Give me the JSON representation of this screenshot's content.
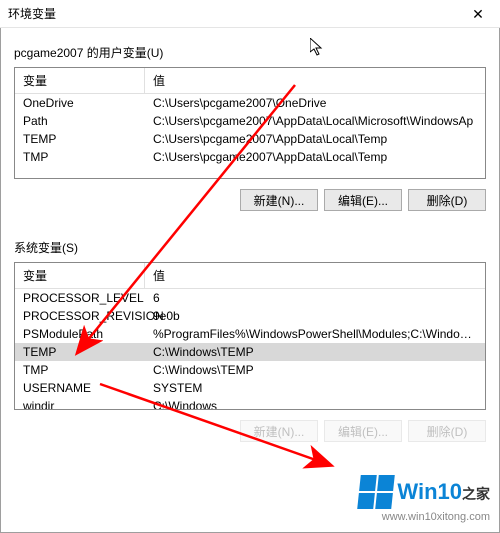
{
  "window": {
    "title": "环境变量",
    "close_glyph": "✕"
  },
  "user_section": {
    "label": "pcgame2007 的用户变量(U)",
    "columns": {
      "name": "变量",
      "value": "值"
    },
    "rows": [
      {
        "name": "OneDrive",
        "value": "C:\\Users\\pcgame2007\\OneDrive"
      },
      {
        "name": "Path",
        "value": "C:\\Users\\pcgame2007\\AppData\\Local\\Microsoft\\WindowsAp"
      },
      {
        "name": "TEMP",
        "value": "C:\\Users\\pcgame2007\\AppData\\Local\\Temp"
      },
      {
        "name": "TMP",
        "value": "C:\\Users\\pcgame2007\\AppData\\Local\\Temp"
      }
    ],
    "buttons": {
      "new": "新建(N)...",
      "edit": "编辑(E)...",
      "delete": "删除(D)"
    }
  },
  "system_section": {
    "label": "系统变量(S)",
    "columns": {
      "name": "变量",
      "value": "值"
    },
    "rows": [
      {
        "name": "PROCESSOR_LEVEL",
        "value": "6"
      },
      {
        "name": "PROCESSOR_REVISION",
        "value": "9e0b"
      },
      {
        "name": "PSModulePath",
        "value": "%ProgramFiles%\\WindowsPowerShell\\Modules;C:\\Windows\\..."
      },
      {
        "name": "TEMP",
        "value": "C:\\Windows\\TEMP",
        "selected": true
      },
      {
        "name": "TMP",
        "value": "C:\\Windows\\TEMP"
      },
      {
        "name": "USERNAME",
        "value": "SYSTEM"
      },
      {
        "name": "windir",
        "value": "C:\\Windows"
      }
    ],
    "buttons": {
      "new": "新建(N)...",
      "edit": "编辑(E)...",
      "delete": "删除(D)"
    }
  },
  "watermark": {
    "brand": "Win10",
    "suffix": "之家",
    "url": "www.win10xitong.com"
  },
  "annotations": {
    "arrow_color": "#ff0000"
  }
}
